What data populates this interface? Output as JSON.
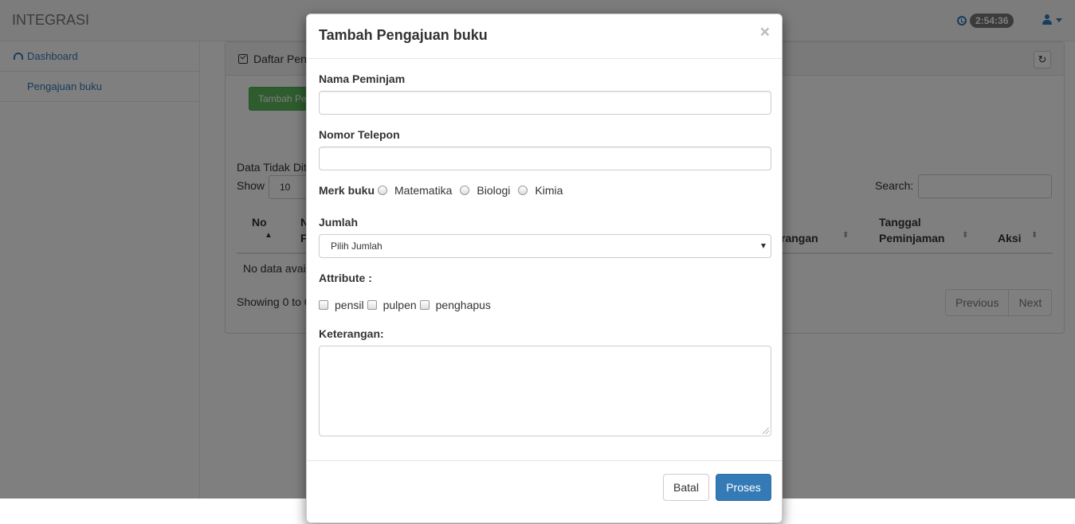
{
  "navbar": {
    "brand": "INTEGRASI",
    "clock_time": "2:54:36"
  },
  "sidebar": {
    "items": [
      {
        "label": "Dashboard"
      },
      {
        "label": "Pengajuan buku"
      }
    ]
  },
  "panel": {
    "title": "Daftar Pen",
    "add_button": "Tambah Pe",
    "data_status": "Data Tidak Dit",
    "show_label": "Show",
    "show_value": "10",
    "search_label": "Search:",
    "table_headers": {
      "no": "No",
      "n": "N",
      "f": "F",
      "keterangan": "rangan",
      "tanggal_line1": "Tanggal",
      "tanggal_line2": "Peminjaman",
      "aksi": "Aksi"
    },
    "no_data": "No data avai",
    "showing": "Showing 0 to 0",
    "pagination": {
      "previous": "Previous",
      "next": "Next"
    }
  },
  "modal": {
    "title": "Tambah Pengajuan buku",
    "close": "×",
    "fields": {
      "nama_label": "Nama Peminjam",
      "nama_value": "",
      "telepon_label": "Nomor Telepon",
      "telepon_value": "",
      "merk_label": "Merk buku",
      "merk_options": [
        "Matematika",
        "Biologi",
        "Kimia"
      ],
      "jumlah_label": "Jumlah",
      "jumlah_selected": "Pilih Jumlah",
      "attribute_label": "Attribute :",
      "attribute_options": [
        "pensil",
        "pulpen",
        "penghapus"
      ],
      "keterangan_label": "Keterangan:",
      "keterangan_value": ""
    },
    "buttons": {
      "cancel": "Batal",
      "submit": "Proses"
    }
  },
  "colors": {
    "primary": "#337ab7",
    "success": "#5cb85c",
    "backdrop": "rgba(0,0,0,0.5)"
  }
}
